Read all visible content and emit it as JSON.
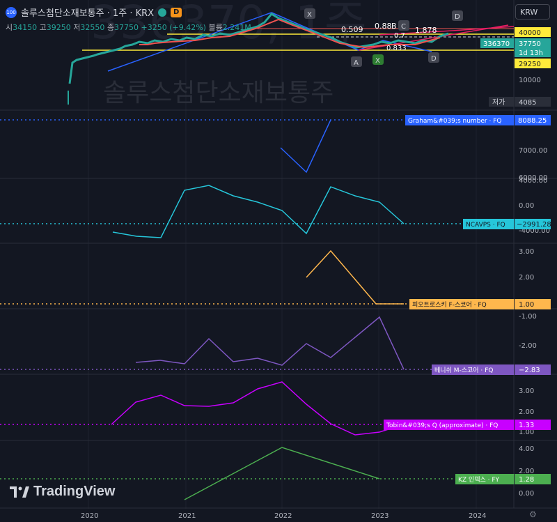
{
  "header": {
    "badge": "100",
    "title": "솔루스첨단소재보통주 · 1주 · KRX",
    "d_badge": "D",
    "ohlc": {
      "open_label": "시",
      "open": "34150",
      "high_label": "고",
      "high": "39250",
      "low_label": "저",
      "low": "32550",
      "close_label": "종",
      "close": "37750",
      "change": "+3250 (+9.42%)",
      "volume_label": "볼륨",
      "volume": "2.241M"
    }
  },
  "currency": "KRW",
  "watermark": "솔루스첨단소재보통주",
  "price_pane": {
    "price_labels": {
      "p40000": "40000",
      "p_symbol": "336370",
      "p_last": "37750",
      "p_timer": "1d 13h",
      "p29250": "29250",
      "p10000": "10000",
      "low_tag": "저가",
      "low_value": "4085"
    },
    "annotations": {
      "a": "A",
      "x": "X",
      "b": "B",
      "c": "C",
      "d": "D",
      "x2": "X",
      "d2": "D",
      "r1": "0.509",
      "r2": "0.88",
      "r3": "0.7",
      "r4": "1.878",
      "r5": "0.833"
    }
  },
  "indicators": [
    {
      "name": "Graham&#039;s number · FQ",
      "value": "8088.25",
      "color": "#2962ff",
      "ticks": [
        "7000.00",
        "6000.00"
      ]
    },
    {
      "name": "NCAVPS · FQ",
      "value": "−2991.28",
      "color": "#26c6da",
      "ticks": [
        "4000.00",
        "0.00",
        "-4000.00"
      ]
    },
    {
      "name": "피오트로스키 F-스코어 · FQ",
      "value": "1.00",
      "color": "#ffb74d",
      "ticks": [
        "3.00",
        "2.00"
      ]
    },
    {
      "name": "베니쉬 M-스코어 · FQ",
      "value": "−2.83",
      "color": "#7e57c2",
      "ticks": [
        "-1.00",
        "-2.00"
      ]
    },
    {
      "name": "Tobin&#039;s Q (approximate) · FQ",
      "value": "1.33",
      "color": "#c800ff",
      "ticks": [
        "3.00",
        "2.00",
        "1.00"
      ]
    },
    {
      "name": "KZ 인덱스 · FY",
      "value": "1.28",
      "color": "#4caf50",
      "ticks": [
        "4.00",
        "2.00",
        "0.00"
      ]
    }
  ],
  "time_axis": [
    "2020",
    "2021",
    "2022",
    "2023",
    "2024"
  ],
  "branding": {
    "logo_text": "TradingView"
  },
  "colors": {
    "background": "#131722",
    "grid": "#2a2e39",
    "up": "#26a69a",
    "down": "#ef5350",
    "yellow": "#ffeb3b"
  }
}
